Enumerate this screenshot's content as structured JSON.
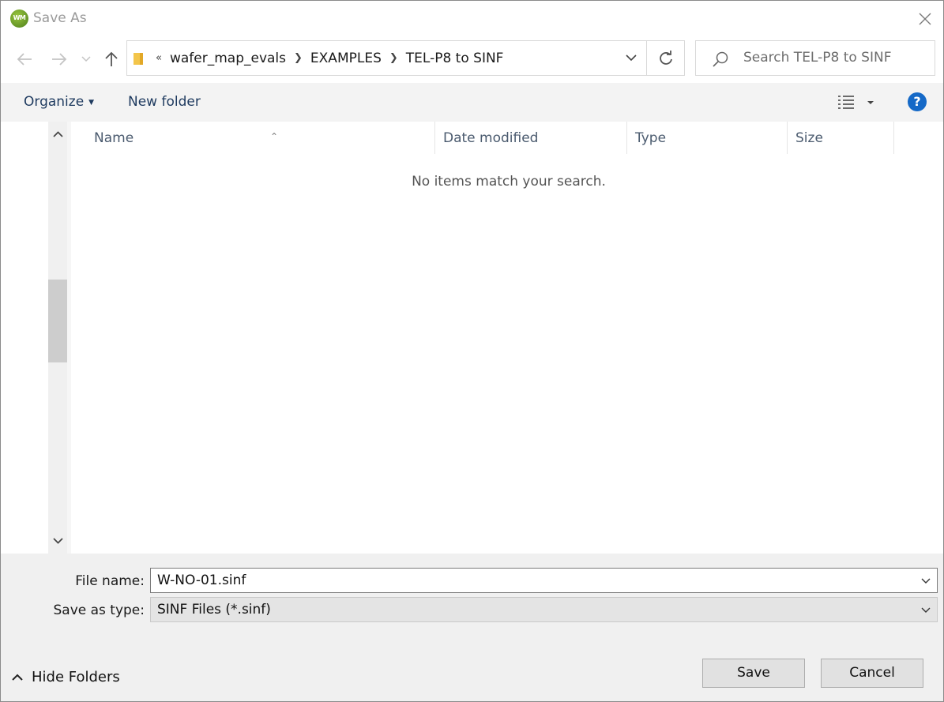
{
  "window": {
    "title": "Save As",
    "app_icon_text": "WM"
  },
  "address": {
    "overflow_glyph": "«",
    "crumbs": [
      "wafer_map_evals",
      "EXAMPLES",
      "TEL-P8 to SINF"
    ]
  },
  "search": {
    "placeholder": "Search TEL-P8 to SINF"
  },
  "toolbar": {
    "organize_label": "Organize",
    "new_folder_label": "New folder",
    "help_label": "?"
  },
  "file_list": {
    "columns": [
      "Name",
      "Date modified",
      "Type",
      "Size"
    ],
    "empty_message": "No items match your search."
  },
  "form": {
    "file_name_label": "File name:",
    "file_name_value": "W-NO-01.sinf",
    "save_type_label": "Save as type:",
    "save_type_value": "SINF Files (*.sinf)"
  },
  "footer": {
    "hide_folders_label": "Hide Folders",
    "save_label": "Save",
    "cancel_label": "Cancel"
  },
  "colors": {
    "accent": "#1569c7",
    "toolbar_text": "#1e3a5f",
    "toolbar_bg": "#f3f3f3",
    "bottom_bg": "#f0f0f0"
  }
}
